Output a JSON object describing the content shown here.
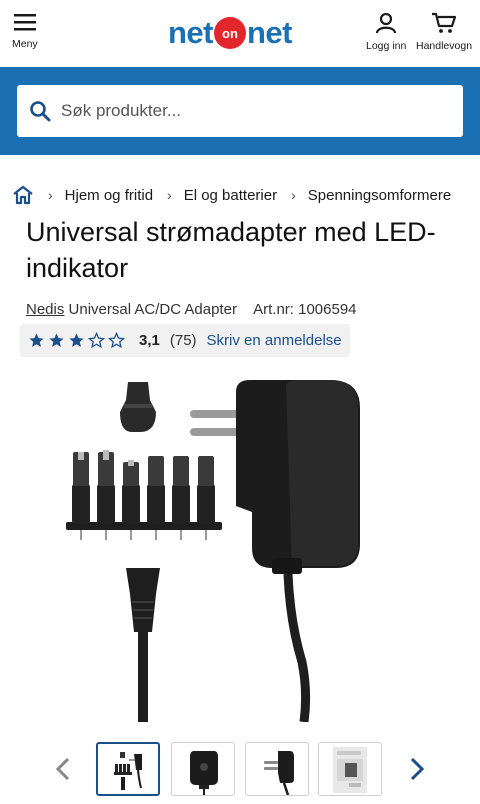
{
  "header": {
    "menu_label": "Meny",
    "login_label": "Logg inn",
    "cart_label": "Handlevogn",
    "logo": {
      "part1": "net",
      "part2": "on",
      "part3": "net"
    }
  },
  "search": {
    "placeholder": "Søk produkter..."
  },
  "breadcrumb": [
    "Hjem og fritid",
    "El og batterier",
    "Spenningsomformere"
  ],
  "product": {
    "title": "Universal strømadapter med LED-indikator",
    "brand": "Nedis",
    "subtitle": "Universal AC/DC Adapter",
    "art_nr": "Art.nr: 1006594",
    "rating": {
      "score": "3,1",
      "count": "(75)",
      "review_label": "Skriv en anmeldelse",
      "stars_value": 3.1,
      "stars_max": 5
    }
  },
  "gallery": {
    "thumbnail_count": 4,
    "active_index": 0
  },
  "colors": {
    "brand_blue": "#1b6fb3",
    "dark_blue": "#1b4f8a",
    "logo_red": "#e3262c"
  }
}
